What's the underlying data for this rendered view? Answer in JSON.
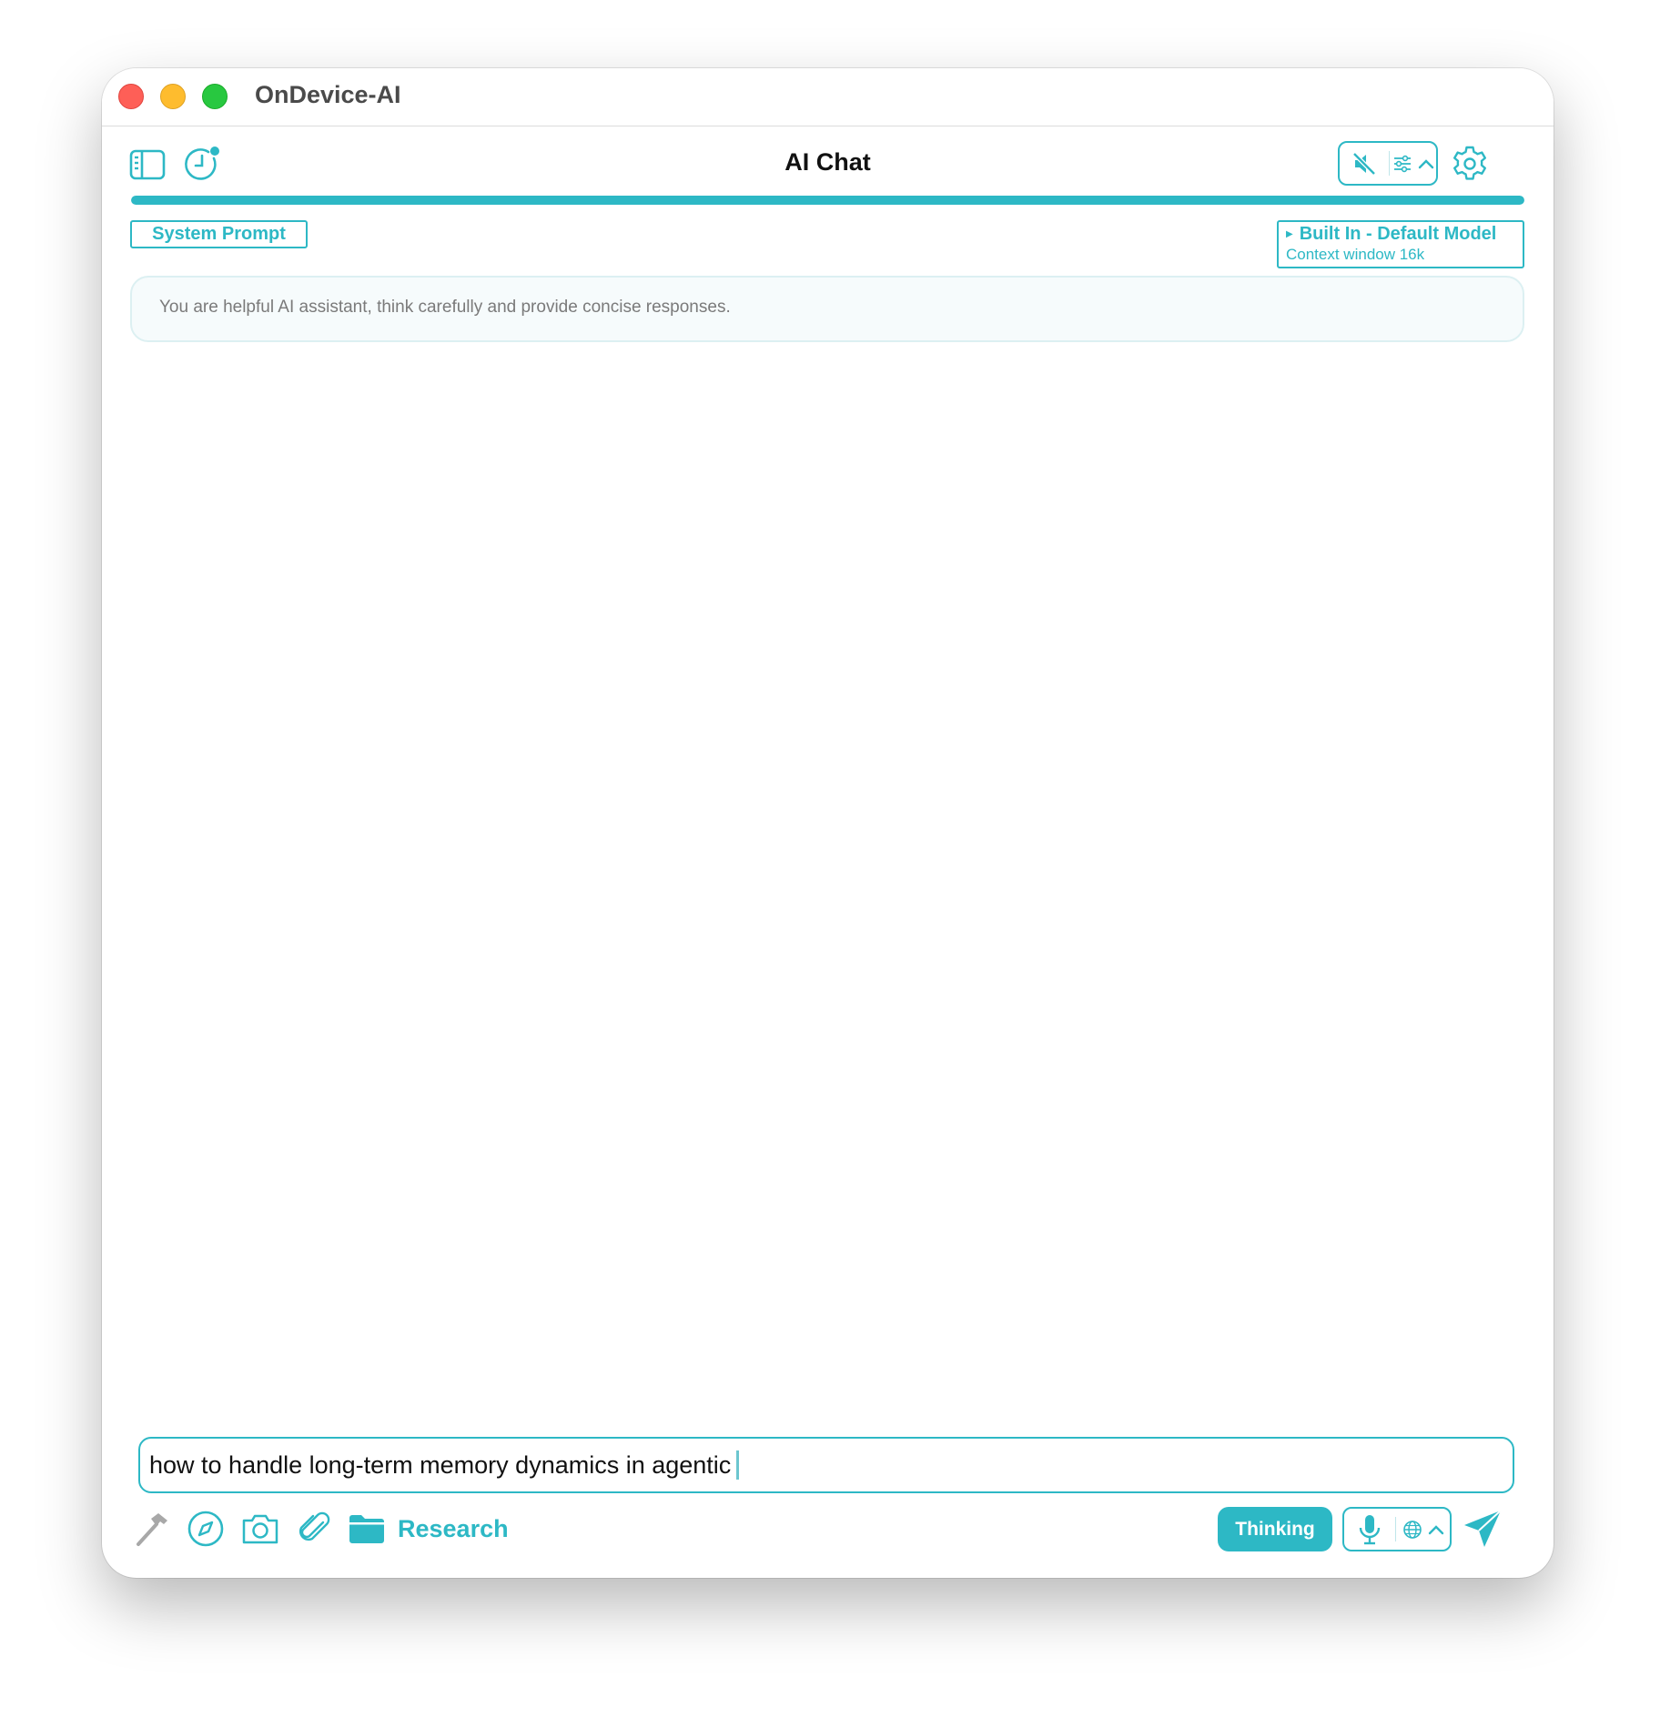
{
  "window": {
    "app_title": "OnDevice-AI"
  },
  "toolbar": {
    "title": "AI Chat",
    "progress_fraction": 1.0
  },
  "system_prompt": {
    "button_label": "System Prompt",
    "text": "You are helpful AI assistant, think carefully and provide concise responses."
  },
  "model": {
    "name": "Built In - Default Model",
    "context": "Context window 16k"
  },
  "composer": {
    "input_value": "how to handle long-term memory dynamics in agentic",
    "research_label": "Research",
    "thinking_label": "Thinking"
  },
  "icons": {
    "sidebar": "sidebar-toggle-icon",
    "history": "history-clock-icon",
    "mute": "speaker-muted-icon",
    "sliders": "sliders-icon",
    "settings": "gear-icon",
    "tools": "hammer-icon",
    "browse": "compass-icon",
    "camera": "camera-icon",
    "attach": "paperclip-icon",
    "folder": "folder-icon",
    "mic": "microphone-icon",
    "language": "globe-icon",
    "send": "paper-plane-icon"
  },
  "colors": {
    "accent": "#2db8c5",
    "close": "#fe5f57",
    "minimize": "#febc2e",
    "zoom": "#28c840"
  }
}
